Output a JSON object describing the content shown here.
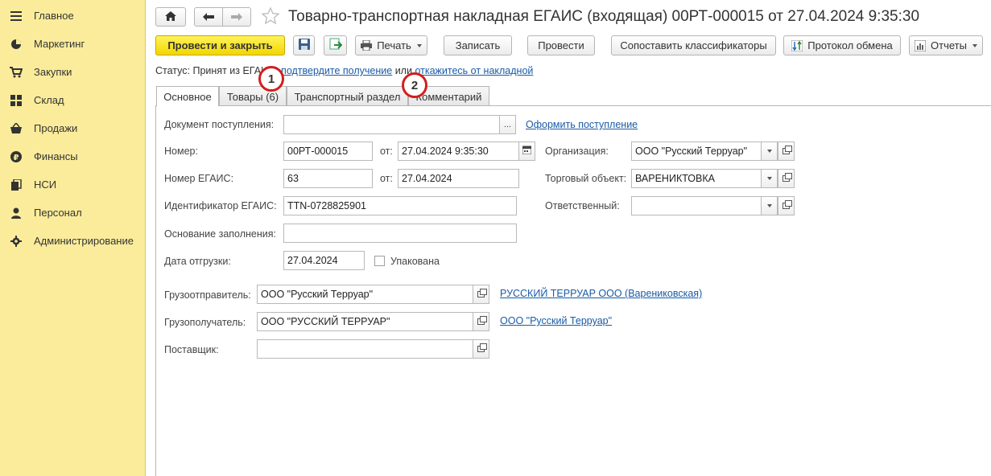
{
  "sidebar": {
    "items": [
      {
        "label": "Главное",
        "icon": "menu-icon"
      },
      {
        "label": "Маркетинг",
        "icon": "pie-chart-icon"
      },
      {
        "label": "Закупки",
        "icon": "cart-icon"
      },
      {
        "label": "Склад",
        "icon": "grid-icon"
      },
      {
        "label": "Продажи",
        "icon": "basket-icon"
      },
      {
        "label": "Финансы",
        "icon": "ruble-coin-icon"
      },
      {
        "label": "НСИ",
        "icon": "book-icon"
      },
      {
        "label": "Персонал",
        "icon": "person-icon"
      },
      {
        "label": "Администрирование",
        "icon": "gear-icon"
      }
    ]
  },
  "header": {
    "title": "Товарно-транспортная накладная ЕГАИС (входящая) 00РТ-000015 от 27.04.2024 9:35:30"
  },
  "toolbar": {
    "post_and_close": "Провести и закрыть",
    "print": "Печать",
    "save": "Записать",
    "post": "Провести",
    "match_classifiers": "Сопоставить классификаторы",
    "exchange_log": "Протокол обмена",
    "reports": "Отчеты"
  },
  "status": {
    "label": "Статус:",
    "text": "Принят из ЕГАИС,",
    "confirm_link": "подтвердите получение",
    "or": "или",
    "reject_link": "откажитесь от накладной"
  },
  "tabs": [
    {
      "label": "Основное",
      "active": true
    },
    {
      "label": "Товары (6)",
      "active": false
    },
    {
      "label": "Транспортный раздел",
      "active": false
    },
    {
      "label": "Комментарий",
      "active": false
    }
  ],
  "markers": [
    "1",
    "2"
  ],
  "form": {
    "receipt_doc": {
      "label": "Документ поступления:",
      "value": "",
      "link": "Оформить поступление"
    },
    "number": {
      "label": "Номер:",
      "value": "00РТ-000015",
      "from_label": "от:",
      "date": "27.04.2024  9:35:30"
    },
    "egais_number": {
      "label": "Номер ЕГАИС:",
      "value": "63",
      "from_label": "от:",
      "date": "27.04.2024"
    },
    "egais_id": {
      "label": "Идентификатор ЕГАИС:",
      "value": "TTN-0728825901"
    },
    "fill_basis": {
      "label": "Основание заполнения:",
      "value": ""
    },
    "ship_date": {
      "label": "Дата отгрузки:",
      "value": "27.04.2024",
      "packed_label": "Упакована",
      "packed": false
    },
    "organization": {
      "label": "Организация:",
      "value": "ООО \"Русский Терруар\""
    },
    "trade_object": {
      "label": "Торговый объект:",
      "value": "ВАРЕНИКТОВКА"
    },
    "responsible": {
      "label": "Ответственный:",
      "value": ""
    },
    "shipper": {
      "label": "Грузоотправитель:",
      "value": "ООО \"Русский Терруар\"",
      "link": "РУССКИЙ ТЕРРУАР ООО (Варениковская)"
    },
    "consignee": {
      "label": "Грузополучатель:",
      "value": "ООО \"РУССКИЙ ТЕРРУАР\"",
      "link": "ООО \"Русский Терруар\""
    },
    "supplier": {
      "label": "Поставщик:",
      "value": ""
    }
  }
}
